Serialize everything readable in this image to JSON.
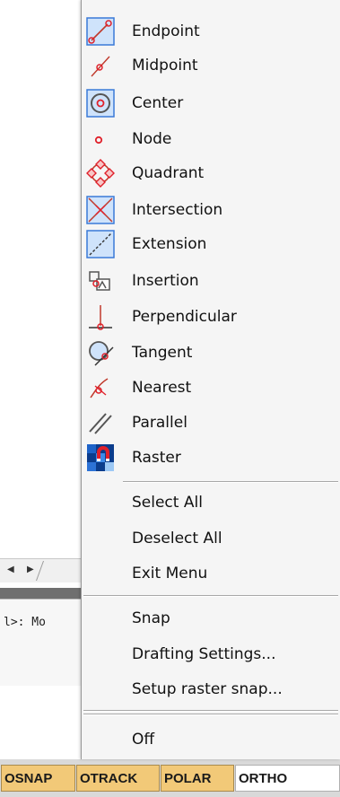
{
  "menu": {
    "snap_items": [
      {
        "label": "Endpoint",
        "icon": "endpoint-icon"
      },
      {
        "label": "Midpoint",
        "icon": "midpoint-icon"
      },
      {
        "label": "Center",
        "icon": "center-icon"
      },
      {
        "label": "Node",
        "icon": "node-icon"
      },
      {
        "label": "Quadrant",
        "icon": "quadrant-icon"
      },
      {
        "label": "Intersection",
        "icon": "intersection-icon"
      },
      {
        "label": "Extension",
        "icon": "extension-icon"
      },
      {
        "label": "Insertion",
        "icon": "insertion-icon"
      },
      {
        "label": "Perpendicular",
        "icon": "perpendicular-icon"
      },
      {
        "label": "Tangent",
        "icon": "tangent-icon"
      },
      {
        "label": "Nearest",
        "icon": "nearest-icon"
      },
      {
        "label": "Parallel",
        "icon": "parallel-icon"
      },
      {
        "label": "Raster",
        "icon": "raster-icon"
      }
    ],
    "select_all": "Select All",
    "deselect_all": "Deselect All",
    "exit_menu": "Exit Menu",
    "snap": "Snap",
    "drafting_settings": "Drafting Settings...",
    "setup_raster_snap": "Setup raster snap...",
    "off": "Off"
  },
  "background": {
    "command_text": "l>: Mo"
  },
  "statusbar": {
    "buttons": [
      {
        "label": "OSNAP",
        "state": "on"
      },
      {
        "label": "OTRACK",
        "state": "on"
      },
      {
        "label": "POLAR",
        "state": "on"
      },
      {
        "label": "ORTHO",
        "state": "off"
      }
    ]
  },
  "colors": {
    "snap_marker": "#e0202a",
    "active_frame": "#3a7ad8",
    "status_on": "#f2c978",
    "menu_bg": "#f5f5f5"
  }
}
